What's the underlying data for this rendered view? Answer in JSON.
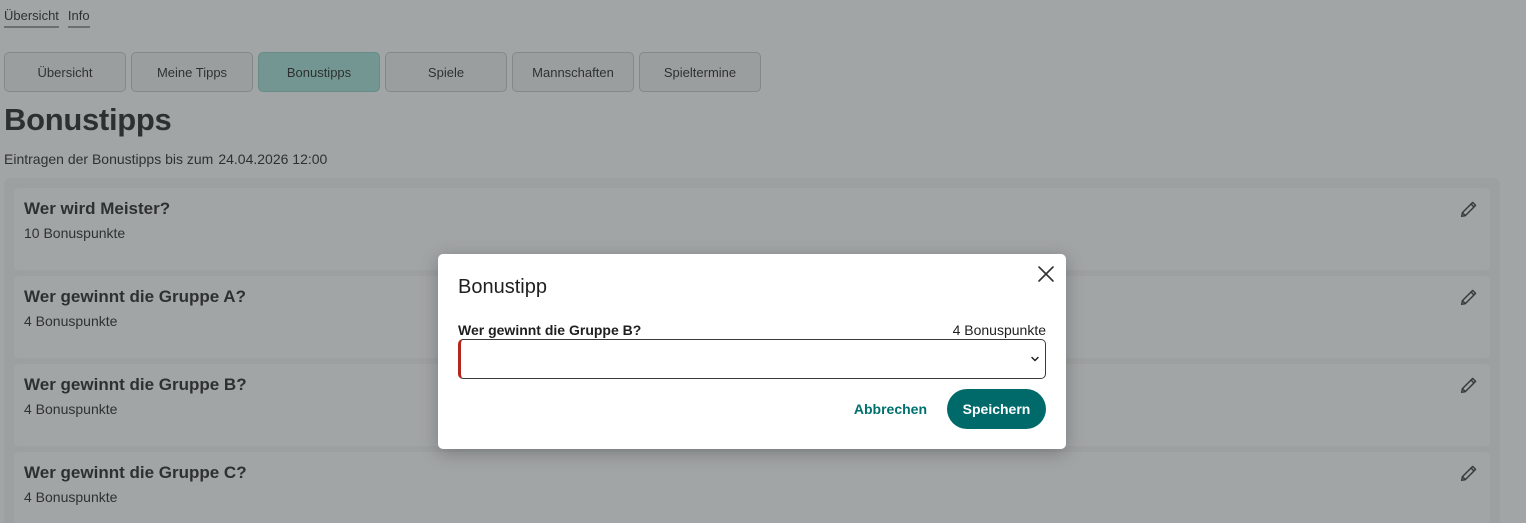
{
  "topnav": {
    "items": [
      "Übersicht",
      "Info"
    ]
  },
  "tabs": [
    {
      "label": "Übersicht",
      "active": false
    },
    {
      "label": "Meine Tipps",
      "active": false
    },
    {
      "label": "Bonustipps",
      "active": true
    },
    {
      "label": "Spiele",
      "active": false
    },
    {
      "label": "Mannschaften",
      "active": false
    },
    {
      "label": "Spieltermine",
      "active": false
    }
  ],
  "page": {
    "title": "Bonustipps",
    "deadline_text": "Eintragen der Bonustipps bis zum",
    "deadline_value": "24.04.2026 12:00"
  },
  "questions": [
    {
      "title": "Wer wird Meister?",
      "points": "10 Bonuspunkte"
    },
    {
      "title": "Wer gewinnt die Gruppe A?",
      "points": "4 Bonuspunkte"
    },
    {
      "title": "Wer gewinnt die Gruppe B?",
      "points": "4 Bonuspunkte"
    },
    {
      "title": "Wer gewinnt die Gruppe C?",
      "points": "4 Bonuspunkte"
    }
  ],
  "dialog": {
    "title": "Bonustipp",
    "question": "Wer gewinnt die Gruppe B?",
    "points": "4 Bonuspunkte",
    "selected_value": "",
    "cancel_label": "Abbrechen",
    "save_label": "Speichern"
  },
  "colors": {
    "accent": "#006a6b",
    "active_tab": "#a6e3d8",
    "error_border": "#b3261e"
  },
  "icons": {
    "edit": "pencil-icon",
    "close": "close-icon",
    "select": "chevron-down-icon"
  }
}
